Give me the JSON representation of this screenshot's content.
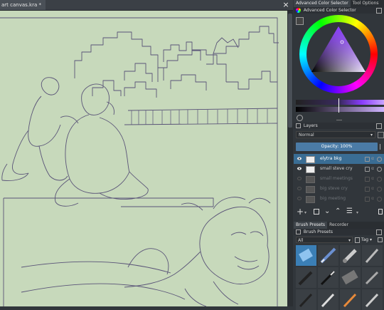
{
  "document": {
    "tab_title": "art canvas.kra *",
    "close_glyph": "×"
  },
  "docker": {
    "top_tabs": [
      "Advanced Color Selector",
      "Tool Options"
    ],
    "color_panel_title": "Advanced Color Selector",
    "layers_title": "Layers",
    "blend_mode": "Normal",
    "opacity_label": "Opacity:",
    "opacity_value": "100%",
    "layers": [
      {
        "name": "elytra bkg",
        "selected": true,
        "visible": true
      },
      {
        "name": "small steve cry",
        "selected": false,
        "visible": true
      },
      {
        "name": "small meetings",
        "selected": false,
        "visible": false
      },
      {
        "name": "big steve cry",
        "selected": false,
        "visible": false
      },
      {
        "name": "big meeting",
        "selected": false,
        "visible": false
      }
    ],
    "layer_alpha_glyph": "α",
    "bottom_tabs": [
      "Brush Presets",
      "Recorder"
    ],
    "brush_title": "Brush Presets",
    "brush_filter": "All",
    "brush_tag_label": "Tag"
  },
  "colors": {
    "canvas_bg": "#c7d9bb",
    "sketch_line": "#5a5478",
    "selection_blue": "#3a6d94",
    "panel_bg": "#31363b"
  }
}
